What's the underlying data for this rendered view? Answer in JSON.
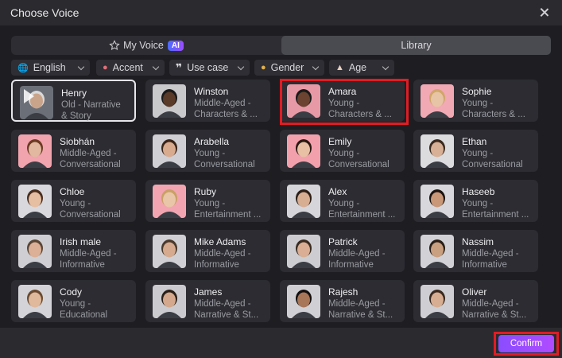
{
  "window": {
    "title": "Choose Voice"
  },
  "tabs": [
    {
      "label": "My Voice",
      "badge": "AI",
      "icon": "star-icon"
    },
    {
      "label": "Library",
      "active": true
    }
  ],
  "filters": [
    {
      "label": "English",
      "icon": "globe-icon"
    },
    {
      "label": "Accent",
      "icon": "lips-icon"
    },
    {
      "label": "Use case",
      "icon": "quote-icon"
    },
    {
      "label": "Gender",
      "icon": "person-icon"
    },
    {
      "label": "Age",
      "icon": "cake-icon"
    }
  ],
  "voices": [
    {
      "name": "Henry",
      "line1": "Old - Narrative",
      "line2": "& Story",
      "selected": true,
      "skin": "#c9a48a",
      "bg": "#6b6f78",
      "hair": "#d9d9d9"
    },
    {
      "name": "Winston",
      "line1": "Middle-Aged -",
      "line2": "Characters & ...",
      "skin": "#5a3a28",
      "bg": "#c9c9cc",
      "hair": "#1a1a1a"
    },
    {
      "name": "Amara",
      "line1": "Young -",
      "line2": "Characters & ...",
      "skin": "#6b4330",
      "bg": "#e79aa6",
      "hair": "#1a1a1a"
    },
    {
      "name": "Sophie",
      "line1": "Young -",
      "line2": "Characters & ...",
      "skin": "#e8c4a6",
      "bg": "#f1a9b4",
      "hair": "#d0a66a"
    },
    {
      "name": "Siobhán",
      "line1": "Middle-Aged -",
      "line2": "Conversational",
      "skin": "#e2b8a0",
      "bg": "#f1a3ae",
      "hair": "#6b3b22"
    },
    {
      "name": "Arabella",
      "line1": "Young -",
      "line2": "Conversational",
      "skin": "#d9ab8e",
      "bg": "#cfcfd4",
      "hair": "#3a2518"
    },
    {
      "name": "Emily",
      "line1": "Young -",
      "line2": "Conversational",
      "skin": "#e8c0a4",
      "bg": "#f3a0ad",
      "hair": "#2a1a12"
    },
    {
      "name": "Ethan",
      "line1": "Young -",
      "line2": "Conversational",
      "skin": "#d8b096",
      "bg": "#dcdcdf",
      "hair": "#3b2a1e"
    },
    {
      "name": "Chloe",
      "line1": "Young -",
      "line2": "Conversational",
      "skin": "#e6bea2",
      "bg": "#d9d9dd",
      "hair": "#4a2e1e"
    },
    {
      "name": "Ruby",
      "line1": "Young -",
      "line2": "Entertainment ...",
      "skin": "#e9c6a8",
      "bg": "#f2a5b1",
      "hair": "#c9a066"
    },
    {
      "name": "Alex",
      "line1": "Young -",
      "line2": "Entertainment ...",
      "skin": "#d8ae92",
      "bg": "#d6d6da",
      "hair": "#2e2018"
    },
    {
      "name": "Haseeb",
      "line1": "Young -",
      "line2": "Entertainment ...",
      "skin": "#c99878",
      "bg": "#d8d8dc",
      "hair": "#1c1410"
    },
    {
      "name": "Irish male",
      "line1": "Middle-Aged -",
      "line2": "Informative",
      "skin": "#dcb096",
      "bg": "#cfcfd3",
      "hair": "#5a4636"
    },
    {
      "name": "Mike Adams",
      "line1": "Middle-Aged -",
      "line2": "Informative",
      "skin": "#d6aa8e",
      "bg": "#d0d0d4",
      "hair": "#4a3a2c"
    },
    {
      "name": "Patrick",
      "line1": "Middle-Aged -",
      "line2": "Informative",
      "skin": "#d9ae94",
      "bg": "#cdcdd1",
      "hair": "#3a2c22"
    },
    {
      "name": "Nassim",
      "line1": "Middle-Aged -",
      "line2": "Informative",
      "skin": "#c9a080",
      "bg": "#d2d2d6",
      "hair": "#2a2018"
    },
    {
      "name": "Cody",
      "line1": "Young -",
      "line2": "Educational",
      "skin": "#e0b89c",
      "bg": "#d4d4d8",
      "hair": "#6a4a30"
    },
    {
      "name": "James",
      "line1": "Middle-Aged -",
      "line2": "Narrative & St...",
      "skin": "#d4a88c",
      "bg": "#cbcbcf",
      "hair": "#2a2018"
    },
    {
      "name": "Rajesh",
      "line1": "Middle-Aged -",
      "line2": "Narrative & St...",
      "skin": "#a87658",
      "bg": "#d0d0d4",
      "hair": "#141010"
    },
    {
      "name": "Oliver",
      "line1": "Middle-Aged -",
      "line2": "Narrative & St...",
      "skin": "#d8ae92",
      "bg": "#cfcfd3",
      "hair": "#3a2a20"
    }
  ],
  "footer": {
    "confirm_label": "Confirm"
  }
}
